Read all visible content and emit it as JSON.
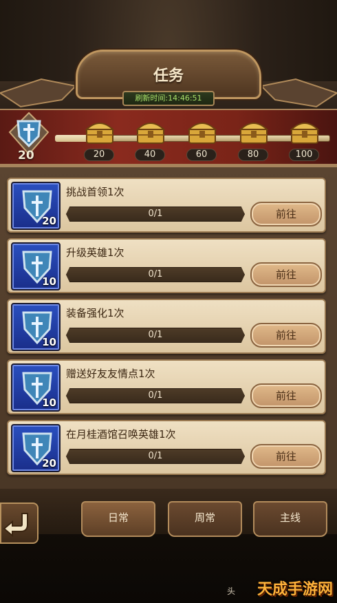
{
  "header": {
    "title": "任务",
    "refresh": "刷新时间:14:46:51"
  },
  "rewards": {
    "current_points": "20",
    "progress_fraction": 0.12,
    "milestones": [
      "20",
      "40",
      "60",
      "80",
      "100"
    ]
  },
  "tasks": [
    {
      "name": "挑战首领1次",
      "progress": "0/1",
      "points": "20",
      "button": "前往"
    },
    {
      "name": "升级英雄1次",
      "progress": "0/1",
      "points": "10",
      "button": "前往"
    },
    {
      "name": "装备强化1次",
      "progress": "0/1",
      "points": "10",
      "button": "前往"
    },
    {
      "name": "赠送好友友情点1次",
      "progress": "0/1",
      "points": "10",
      "button": "前往"
    },
    {
      "name": "在月桂酒馆召唤英雄1次",
      "progress": "0/1",
      "points": "20",
      "button": "前往"
    }
  ],
  "tabs": [
    {
      "label": "日常"
    },
    {
      "label": "周常"
    },
    {
      "label": "主线"
    }
  ],
  "footer": {
    "partial_text": "头",
    "watermark": "天成手游网"
  },
  "colors": {
    "icon_blue": "#2a4fbf",
    "refresh_green": "#a8e06a",
    "track_red": "#8a2a1e"
  }
}
